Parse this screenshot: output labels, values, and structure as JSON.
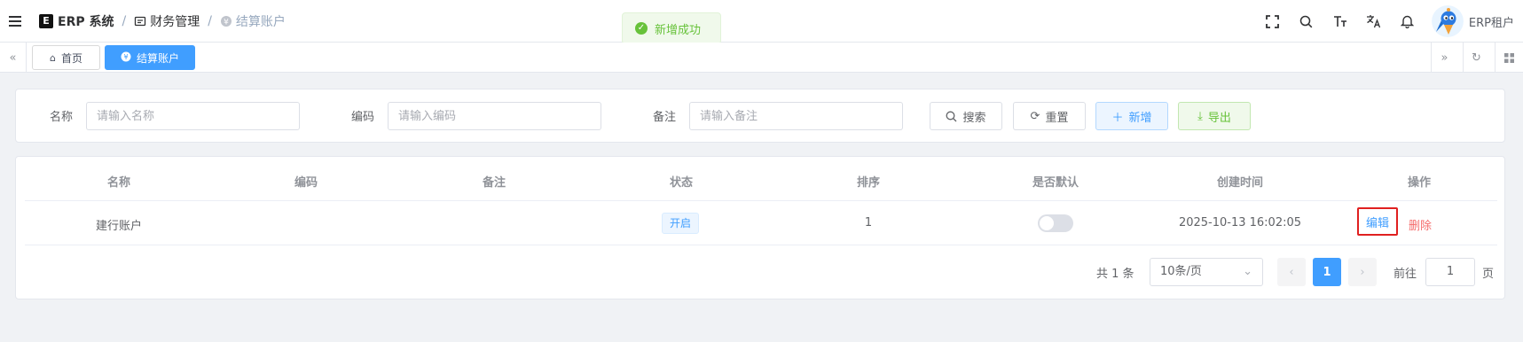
{
  "header": {
    "brand": "ERP 系统",
    "brand_logo": "E",
    "breadcrumb": [
      {
        "label": "财务管理",
        "icon": "ledger-icon"
      },
      {
        "label": "结算账户",
        "icon": "account-icon"
      }
    ],
    "separator": "/",
    "user": "ERP租户",
    "tools": [
      "fullscreen-icon",
      "search-icon",
      "font-size-icon",
      "translate-icon",
      "bell-icon"
    ]
  },
  "toast": {
    "text": "新增成功",
    "type": "success",
    "color": "#67c23a"
  },
  "tags": {
    "items": [
      {
        "label": "首页",
        "icon": "home-icon",
        "active": false
      },
      {
        "label": "结算账户",
        "icon": "account-icon",
        "active": true
      }
    ]
  },
  "filters": {
    "name_label": "名称",
    "name_placeholder": "请输入名称",
    "name_value": "",
    "code_label": "编码",
    "code_placeholder": "请输入编码",
    "code_value": "",
    "remark_label": "备注",
    "remark_placeholder": "请输入备注",
    "remark_value": "",
    "search": "搜索",
    "reset": "重置",
    "add": "新增",
    "export": "导出"
  },
  "table": {
    "columns": [
      "名称",
      "编码",
      "备注",
      "状态",
      "排序",
      "是否默认",
      "创建时间",
      "操作"
    ],
    "rows": [
      {
        "name": "建行账户",
        "code": "",
        "remark": "",
        "status": "开启",
        "sort": "1",
        "is_default": false,
        "created": "2025-10-13 16:02:05",
        "edit": "编辑",
        "delete": "删除"
      }
    ]
  },
  "pagination": {
    "total": "共 1 条",
    "page_size": "10条/页",
    "current_page": "1",
    "goto": "前往",
    "jump_value": "1",
    "page_unit": "页"
  },
  "colors": {
    "primary": "#409eff",
    "success": "#67c23a",
    "danger": "#f56c6c",
    "highlight": "#e02020"
  }
}
